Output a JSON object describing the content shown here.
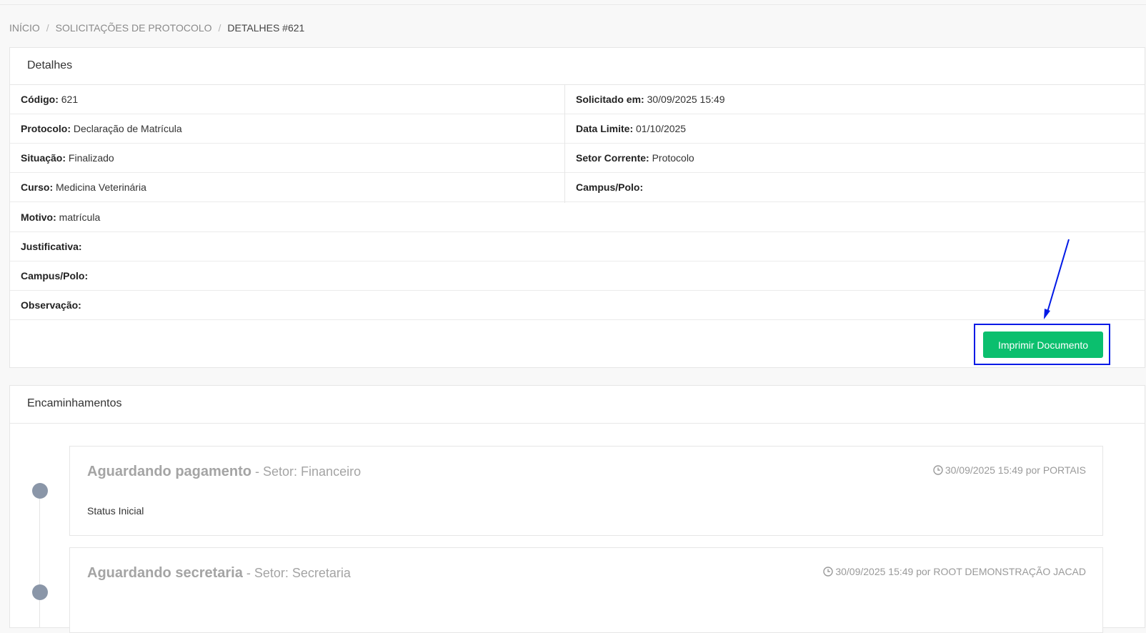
{
  "breadcrumb": [
    {
      "label": "INÍCIO"
    },
    {
      "label": "SOLICITAÇÕES DE PROTOCOLO"
    },
    {
      "label": "DETALHES #621"
    }
  ],
  "details": {
    "title": "Detalhes",
    "left": [
      {
        "label": "Código:",
        "value": " 621"
      },
      {
        "label": "Protocolo:",
        "value": " Declaração de Matrícula"
      },
      {
        "label": "Situação:",
        "value": " Finalizado"
      },
      {
        "label": "Curso:",
        "value": " Medicina Veterinária"
      }
    ],
    "right": [
      {
        "label": "Solicitado em:",
        "value": " 30/09/2025 15:49"
      },
      {
        "label": "Data Limite:",
        "value": " 01/10/2025"
      },
      {
        "label": "Setor Corrente:",
        "value": " Protocolo"
      },
      {
        "label": "Campus/Polo:",
        "value": ""
      }
    ],
    "full": [
      {
        "label": "Motivo:",
        "value": " matrícula"
      },
      {
        "label": "Justificativa:",
        "value": ""
      },
      {
        "label": "Campus/Polo:",
        "value": ""
      },
      {
        "label": "Observação:",
        "value": ""
      }
    ],
    "print_button": "Imprimir Documento"
  },
  "forwardings": {
    "title": "Encaminhamentos",
    "items": [
      {
        "status": "Aguardando pagamento",
        "sector": " - Setor: Financeiro",
        "meta": "30/09/2025 15:49 por PORTAIS",
        "note": "Status Inicial"
      },
      {
        "status": "Aguardando secretaria",
        "sector": " - Setor: Secretaria",
        "meta": "30/09/2025 15:49 por ROOT DEMONSTRAÇÃO JACAD",
        "note": ""
      }
    ]
  },
  "colors": {
    "print_button": "#0bbf6e",
    "highlight_box": "#0019e6",
    "timeline_dot": "#8a96a8"
  }
}
